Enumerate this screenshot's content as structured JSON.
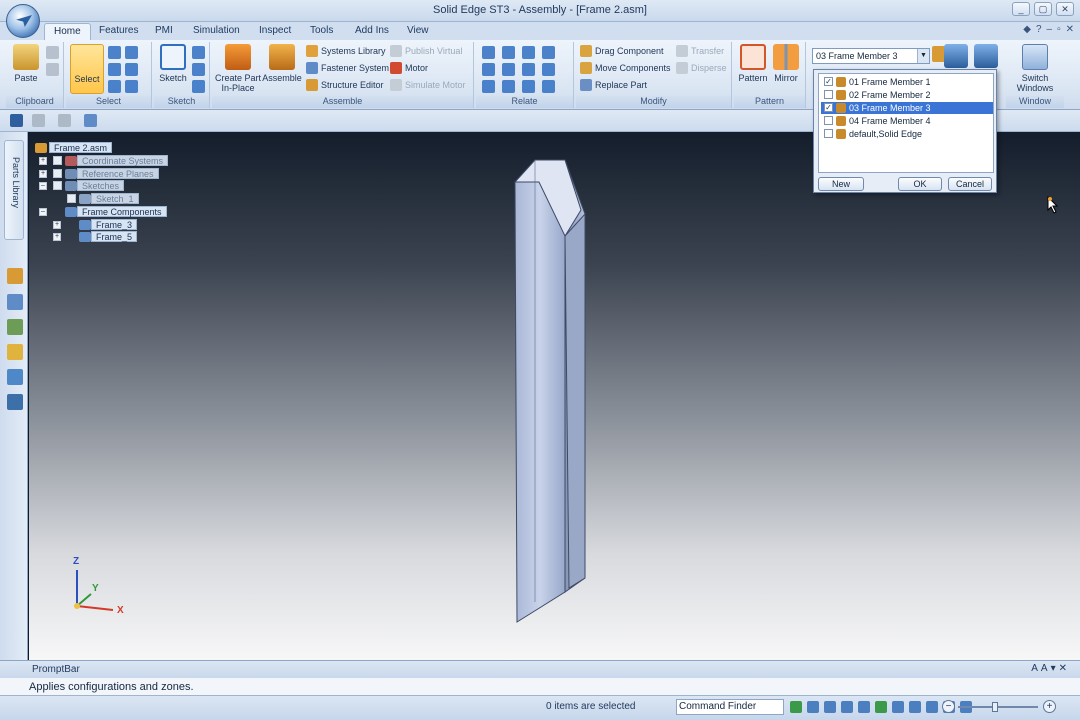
{
  "window": {
    "title": "Solid Edge ST3 - Assembly - [Frame 2.asm]",
    "buttons": [
      "_",
      "▢",
      "✕"
    ]
  },
  "ribbon_tabs": [
    "Home",
    "Features",
    "PMI",
    "Simulation",
    "Inspect",
    "Tools",
    "Add Ins",
    "View"
  ],
  "ribbon": {
    "clipboard": {
      "paste": "Paste",
      "label": "Clipboard"
    },
    "select": {
      "select": "Select",
      "label": "Select"
    },
    "sketch": {
      "sketch": "Sketch",
      "label": "Sketch"
    },
    "assemble": {
      "create_part": "Create Part In-Place",
      "assemble": "Assemble",
      "systems_library": "Systems Library",
      "fastener_system": "Fastener System",
      "structure_editor": "Structure Editor",
      "publish_virtual": "Publish Virtual",
      "motor": "Motor",
      "simulate_motor": "Simulate Motor",
      "label": "Assemble"
    },
    "relate": {
      "label": "Relate"
    },
    "modify": {
      "drag_component": "Drag Component",
      "move_components": "Move Components",
      "replace_part": "Replace Part",
      "transfer": "Transfer",
      "disperse": "Disperse",
      "label": "Modify"
    },
    "pattern": {
      "pattern": "Pattern",
      "mirror": "Mirror",
      "label": "Pattern"
    },
    "configuration_combo": "03 Frame Member 3",
    "window": {
      "switch_windows": "Switch Windows",
      "label": "Window"
    }
  },
  "left_panel": {
    "parts_library": "Parts Library"
  },
  "tree": [
    {
      "label": "Frame 2.asm"
    },
    {
      "label": "Coordinate Systems"
    },
    {
      "label": "Reference Planes"
    },
    {
      "label": "Sketches"
    },
    {
      "label": "Sketch_1"
    },
    {
      "label": "Frame Components"
    },
    {
      "label": "Frame_3"
    },
    {
      "label": "Frame_5"
    }
  ],
  "config_dialog": {
    "items": [
      {
        "label": "01 Frame Member 1",
        "checked": true
      },
      {
        "label": "02 Frame Member 2",
        "checked": false
      },
      {
        "label": "03 Frame Member 3",
        "checked": true,
        "selected": true
      },
      {
        "label": "04 Frame Member 4",
        "checked": false
      },
      {
        "label": "default,Solid Edge",
        "checked": false
      }
    ],
    "new": "New",
    "ok": "OK",
    "cancel": "Cancel"
  },
  "axes": {
    "z": "Z",
    "y": "Y",
    "x": "X"
  },
  "promptbar": {
    "title": "PromptBar",
    "text": "Applies configurations and zones."
  },
  "status": {
    "selection": "0 items are selected",
    "command_finder": "Command Finder"
  },
  "colors": {
    "accent": "#3a75d6",
    "ribbon_bg": "#dbe6f3",
    "select_highlight": "#ffc64a"
  }
}
